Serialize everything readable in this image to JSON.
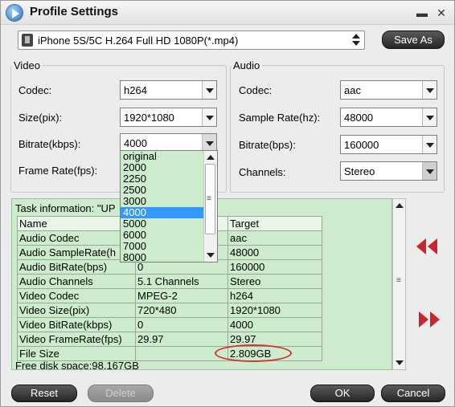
{
  "window": {
    "title": "Profile Settings",
    "minimize_glyph": "▬",
    "close_glyph": "✕"
  },
  "profile": {
    "selected": "iPhone 5S/5C H.264 Full HD 1080P(*.mp4)",
    "save_as_label": "Save As"
  },
  "video": {
    "group_label": "Video",
    "codec_label": "Codec:",
    "codec_value": "h264",
    "size_label": "Size(pix):",
    "size_value": "1920*1080",
    "bitrate_label": "Bitrate(kbps):",
    "bitrate_value": "4000",
    "framerate_label": "Frame Rate(fps):"
  },
  "audio": {
    "group_label": "Audio",
    "codec_label": "Codec:",
    "codec_value": "aac",
    "samplerate_label": "Sample Rate(hz):",
    "samplerate_value": "48000",
    "bitrate_label": "Bitrate(bps):",
    "bitrate_value": "160000",
    "channels_label": "Channels:",
    "channels_value": "Stereo"
  },
  "bitrate_dropdown": {
    "options": [
      "original",
      "2000",
      "2250",
      "2500",
      "3000",
      "4000",
      "5000",
      "6000",
      "7000",
      "8000"
    ],
    "selected": "4000"
  },
  "task_info": {
    "heading": "Task information: \"UP",
    "columns": [
      "Name",
      "",
      "Target"
    ],
    "rows": [
      [
        "Audio Codec",
        "",
        "aac"
      ],
      [
        "Audio SampleRate(h",
        "",
        "48000"
      ],
      [
        "Audio BitRate(bps)",
        "0",
        "160000"
      ],
      [
        "Audio Channels",
        "5.1 Channels",
        "Stereo"
      ],
      [
        "Video Codec",
        "MPEG-2",
        "h264"
      ],
      [
        "Video Size(pix)",
        "720*480",
        "1920*1080"
      ],
      [
        "Video BitRate(kbps)",
        "0",
        "4000"
      ],
      [
        "Video FrameRate(fps)",
        "29.97",
        "29.97"
      ],
      [
        "File Size",
        "",
        "2.809GB"
      ]
    ],
    "free_disk": "Free disk space:98.167GB"
  },
  "buttons": {
    "reset": "Reset",
    "delete": "Delete",
    "ok": "OK",
    "cancel": "Cancel"
  },
  "colors": {
    "panel_green": "#cdeccd",
    "arrow_red": "#c9252b",
    "highlight_oval": "#d43030",
    "selection_blue": "#3399ff"
  }
}
